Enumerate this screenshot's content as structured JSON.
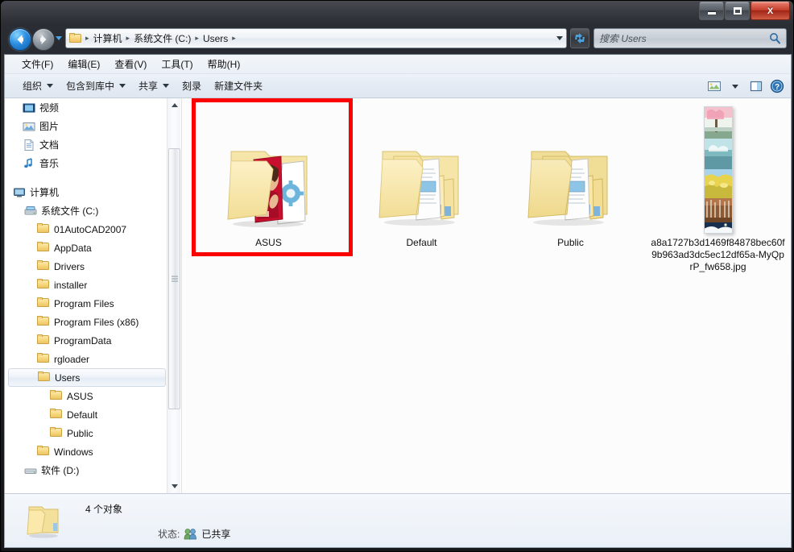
{
  "window": {
    "controls": {
      "minimize_label": "Minimize",
      "maximize_label": "Maximize",
      "close_label": "X"
    }
  },
  "address": {
    "breadcrumbs": [
      {
        "label": "计算机"
      },
      {
        "label": "系统文件 (C:)"
      },
      {
        "label": "Users"
      }
    ],
    "separator": "▸"
  },
  "search": {
    "placeholder": "搜索 Users",
    "value": ""
  },
  "menubar": {
    "items": [
      {
        "label": "文件(F)"
      },
      {
        "label": "编辑(E)"
      },
      {
        "label": "查看(V)"
      },
      {
        "label": "工具(T)"
      },
      {
        "label": "帮助(H)"
      }
    ]
  },
  "toolbar": {
    "items": [
      {
        "label": "组织",
        "caret": true
      },
      {
        "label": "包含到库中",
        "caret": true
      },
      {
        "label": "共享",
        "caret": true
      },
      {
        "label": "刻录",
        "caret": false
      },
      {
        "label": "新建文件夹",
        "caret": false
      }
    ],
    "right_icons": [
      {
        "name": "change-view-icon"
      },
      {
        "name": "change-view-caret"
      },
      {
        "name": "preview-pane-icon"
      },
      {
        "name": "help-icon"
      }
    ]
  },
  "sidebar": {
    "items": [
      {
        "label": "视频",
        "icon": "video-icon",
        "indent": 22,
        "selected": false
      },
      {
        "label": "图片",
        "icon": "picture-icon",
        "indent": 22,
        "selected": false
      },
      {
        "label": "文档",
        "icon": "document-icon",
        "indent": 22,
        "selected": false
      },
      {
        "label": "音乐",
        "icon": "music-icon",
        "indent": 22,
        "selected": false
      },
      {
        "label": "计算机",
        "icon": "computer-icon",
        "indent": 10,
        "selected": false
      },
      {
        "label": "系统文件 (C:)",
        "icon": "harddrive-icon",
        "indent": 24,
        "selected": false
      },
      {
        "label": "01AutoCAD2007",
        "icon": "folder-icon",
        "indent": 40,
        "selected": false
      },
      {
        "label": "AppData",
        "icon": "folder-icon",
        "indent": 40,
        "selected": false
      },
      {
        "label": "Drivers",
        "icon": "folder-icon",
        "indent": 40,
        "selected": false
      },
      {
        "label": "installer",
        "icon": "folder-icon",
        "indent": 40,
        "selected": false
      },
      {
        "label": "Program Files",
        "icon": "folder-icon",
        "indent": 40,
        "selected": false
      },
      {
        "label": "Program Files (x86)",
        "icon": "folder-icon",
        "indent": 40,
        "selected": false
      },
      {
        "label": "ProgramData",
        "icon": "folder-icon",
        "indent": 40,
        "selected": false
      },
      {
        "label": "rgloader",
        "icon": "folder-icon",
        "indent": 40,
        "selected": false
      },
      {
        "label": "Users",
        "icon": "folder-icon",
        "indent": 40,
        "selected": true
      },
      {
        "label": "ASUS",
        "icon": "folder-icon",
        "indent": 56,
        "selected": false
      },
      {
        "label": "Default",
        "icon": "folder-icon",
        "indent": 56,
        "selected": false
      },
      {
        "label": "Public",
        "icon": "folder-icon",
        "indent": 56,
        "selected": false
      },
      {
        "label": "Windows",
        "icon": "folder-icon",
        "indent": 40,
        "selected": false
      },
      {
        "label": "软件 (D:)",
        "icon": "drive-icon",
        "indent": 24,
        "selected": false
      }
    ]
  },
  "files": [
    {
      "name": "ASUS",
      "type": "folder-with-pictures",
      "highlighted": true
    },
    {
      "name": "Default",
      "type": "folder-with-documents",
      "highlighted": false
    },
    {
      "name": "Public",
      "type": "folder-with-documents",
      "highlighted": false
    },
    {
      "name": "a8a1727b3d1469f84878bec60f9b963ad3dc5ec12df65a-MyQprP_fw658.jpg",
      "type": "image-thumbnail",
      "highlighted": false
    }
  ],
  "statusbar": {
    "item_count": "4 个对象",
    "status_label": "状态:",
    "status_value": "已共享",
    "icon": "folder-icon"
  },
  "colors": {
    "annotation": "#fa0000",
    "folder_yellow": "#f6d67c",
    "selection_blue": "#cfd9e6",
    "close_red": "#c6402c"
  }
}
